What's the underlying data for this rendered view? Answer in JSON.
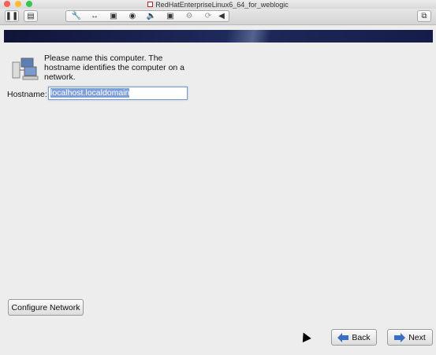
{
  "window": {
    "title": "RedHatEnterpriseLinux6_64_for_weblogic",
    "traffic_colors": [
      "#fc5f57",
      "#fdbc2e",
      "#34c84a"
    ]
  },
  "toolbar": {
    "icons": [
      "pause-icon",
      "snapshot-icon",
      "settings-icon",
      "network-arrows-icon",
      "hard-disk-icon",
      "cd-dvd-icon",
      "sound-icon",
      "camera-icon",
      "usb-icon",
      "sharing-icon",
      "left-arrow-icon",
      "fullscreen-icon"
    ]
  },
  "installer": {
    "banner_color": "#141a46",
    "instruction": "Please name this computer.  The hostname identifies the computer on a network.",
    "hostname_label": "Hostname:",
    "hostname_value": "localhost.localdomain",
    "configure_network_label": "Configure Network",
    "back_label": "Back",
    "next_label": "Next",
    "arrow_color": "#3a6fbf"
  }
}
